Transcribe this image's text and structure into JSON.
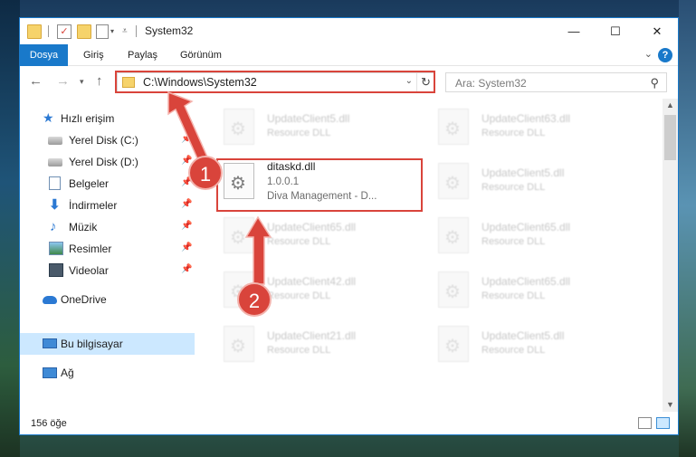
{
  "window": {
    "title": "System32",
    "minimize": "—",
    "maximize": "☐",
    "close": "✕"
  },
  "ribbon": {
    "tabs": [
      "Dosya",
      "Giriş",
      "Paylaş",
      "Görünüm"
    ],
    "help": "?",
    "collapse": "⌄"
  },
  "address": {
    "path": "C:\\Windows\\System32"
  },
  "search": {
    "placeholder": "Ara: System32"
  },
  "nav": {
    "items": [
      {
        "label": "Hızlı erişim",
        "icon": "star-icon"
      },
      {
        "label": "Yerel Disk (C:)",
        "icon": "drive-icon",
        "pinned": true
      },
      {
        "label": "Yerel Disk (D:)",
        "icon": "drive-icon",
        "pinned": true
      },
      {
        "label": "Belgeler",
        "icon": "documents-icon",
        "pinned": true
      },
      {
        "label": "İndirmeler",
        "icon": "download-icon",
        "pinned": true
      },
      {
        "label": "Müzik",
        "icon": "music-icon",
        "pinned": true
      },
      {
        "label": "Resimler",
        "icon": "pictures-icon",
        "pinned": true
      },
      {
        "label": "Videolar",
        "icon": "videos-icon",
        "pinned": true
      },
      {
        "label": "OneDrive",
        "icon": "cloud-icon"
      },
      {
        "label": "Bu bilgisayar",
        "icon": "computer-icon",
        "selected": true
      },
      {
        "label": "Ağ",
        "icon": "network-icon"
      }
    ]
  },
  "files": {
    "left": [
      {
        "name": "UpdateClient5.dll",
        "sub": "Resource DLL"
      },
      {
        "name": "ditaskd.dll",
        "version": "1.0.0.1",
        "desc": "Diva Management - D...",
        "highlight": true
      },
      {
        "name": "UpdateClient65.dll",
        "sub": "Resource DLL"
      },
      {
        "name": "UpdateClient42.dll",
        "sub": "Resource DLL"
      },
      {
        "name": "UpdateClient21.dll",
        "sub": "Resource DLL"
      }
    ],
    "right": [
      {
        "name": "UpdateClient63.dll",
        "sub": "Resource DLL"
      },
      {
        "name": "UpdateClient5.dll",
        "sub": "Resource DLL"
      },
      {
        "name": "UpdateClient65.dll",
        "sub": "Resource DLL"
      },
      {
        "name": "UpdateClient65.dll",
        "sub": "Resource DLL"
      },
      {
        "name": "UpdateClient5.dll",
        "sub": "Resource DLL"
      }
    ]
  },
  "status": {
    "count": "156 öğe"
  },
  "annotations": {
    "step1": "1",
    "step2": "2",
    "color": "#d9443b"
  }
}
